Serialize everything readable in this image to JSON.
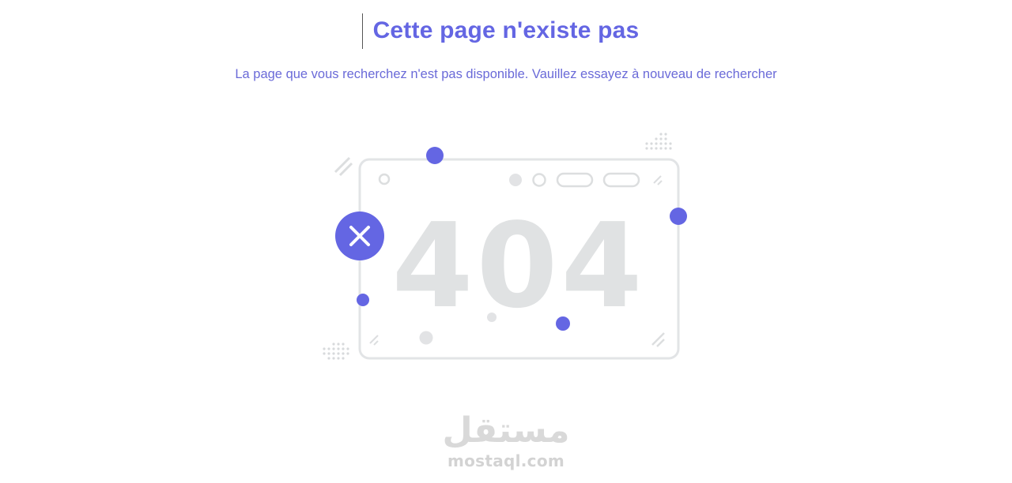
{
  "header": {
    "title": "Cette page n'existe pas",
    "subtitle": "La page que vous recherchez n'est pas disponible. Vauillez essayez à nouveau de rechercher"
  },
  "illustration": {
    "error_code": "404",
    "status_icon": "close-icon"
  },
  "watermark": {
    "arabic": "مستقل",
    "latin": "mostaql.com"
  },
  "colors": {
    "accent": "#6466e3",
    "subtitle": "#6a6ad8",
    "frame": "#e2e4e6",
    "code": "#e0e2e3",
    "watermark": "#d9d9d9"
  }
}
